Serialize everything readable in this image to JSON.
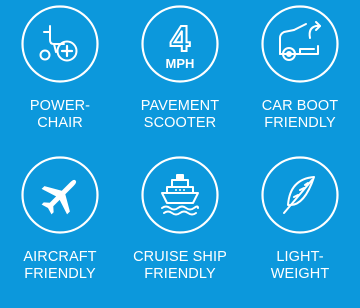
{
  "colors": {
    "background": "#0c98dc",
    "foreground": "#ffffff"
  },
  "features": [
    {
      "icon": "wheelchair-plus-icon",
      "label_line1": "POWER-",
      "label_line2": "CHAIR"
    },
    {
      "icon": "speed-4-mph-icon",
      "speed_number": "4",
      "speed_unit": "MPH",
      "label_line1": "PAVEMENT",
      "label_line2": "SCOOTER"
    },
    {
      "icon": "car-boot-icon",
      "label_line1": "CAR BOOT",
      "label_line2": "FRIENDLY"
    },
    {
      "icon": "airplane-icon",
      "label_line1": "AIRCRAFT",
      "label_line2": "FRIENDLY"
    },
    {
      "icon": "cruise-ship-icon",
      "label_line1": "CRUISE SHIP",
      "label_line2": "FRIENDLY"
    },
    {
      "icon": "feather-icon",
      "label_line1": "LIGHT-",
      "label_line2": "WEIGHT"
    }
  ]
}
